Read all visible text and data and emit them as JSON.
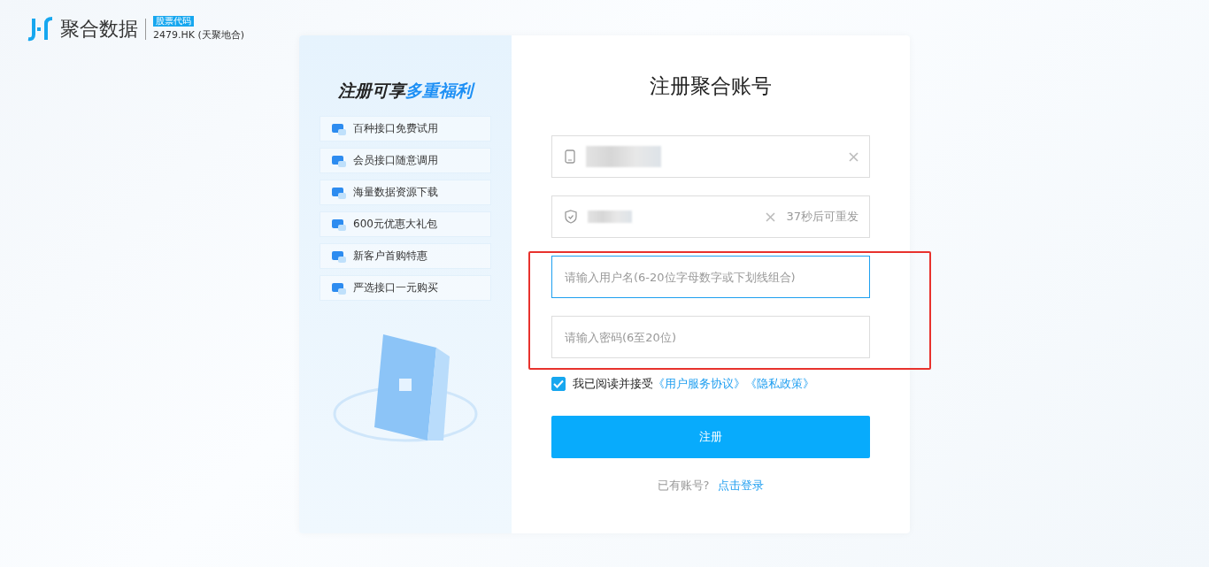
{
  "logo": {
    "brand": "聚合数据",
    "badge": "股票代码",
    "stock": "2479.HK (天聚地合)"
  },
  "promo": {
    "title_plain": "注册可享",
    "title_accent": "多重福利",
    "items": [
      "百种接口免费试用",
      "会员接口随意调用",
      "海量数据资源下载",
      "600元优惠大礼包",
      "新客户首购特惠",
      "严选接口一元购买"
    ]
  },
  "form": {
    "title": "注册聚合账号",
    "fields": [
      {
        "kind": "phone",
        "focused": false
      },
      {
        "kind": "code",
        "focused": false,
        "resend": "37秒后可重发"
      },
      {
        "kind": "text",
        "focused": true,
        "placeholder": "请输入用户名(6-20位字母数字或下划线组合)"
      },
      {
        "kind": "text",
        "focused": false,
        "placeholder": "请输入密码(6至20位)"
      }
    ],
    "agreement": {
      "checked": true,
      "text": "我已阅读并接受",
      "links": [
        "《用户服务协议》",
        "《隐私政策》"
      ]
    },
    "submit": "注册",
    "login_prompt": "已有账号?",
    "login_link": "点击登录"
  }
}
